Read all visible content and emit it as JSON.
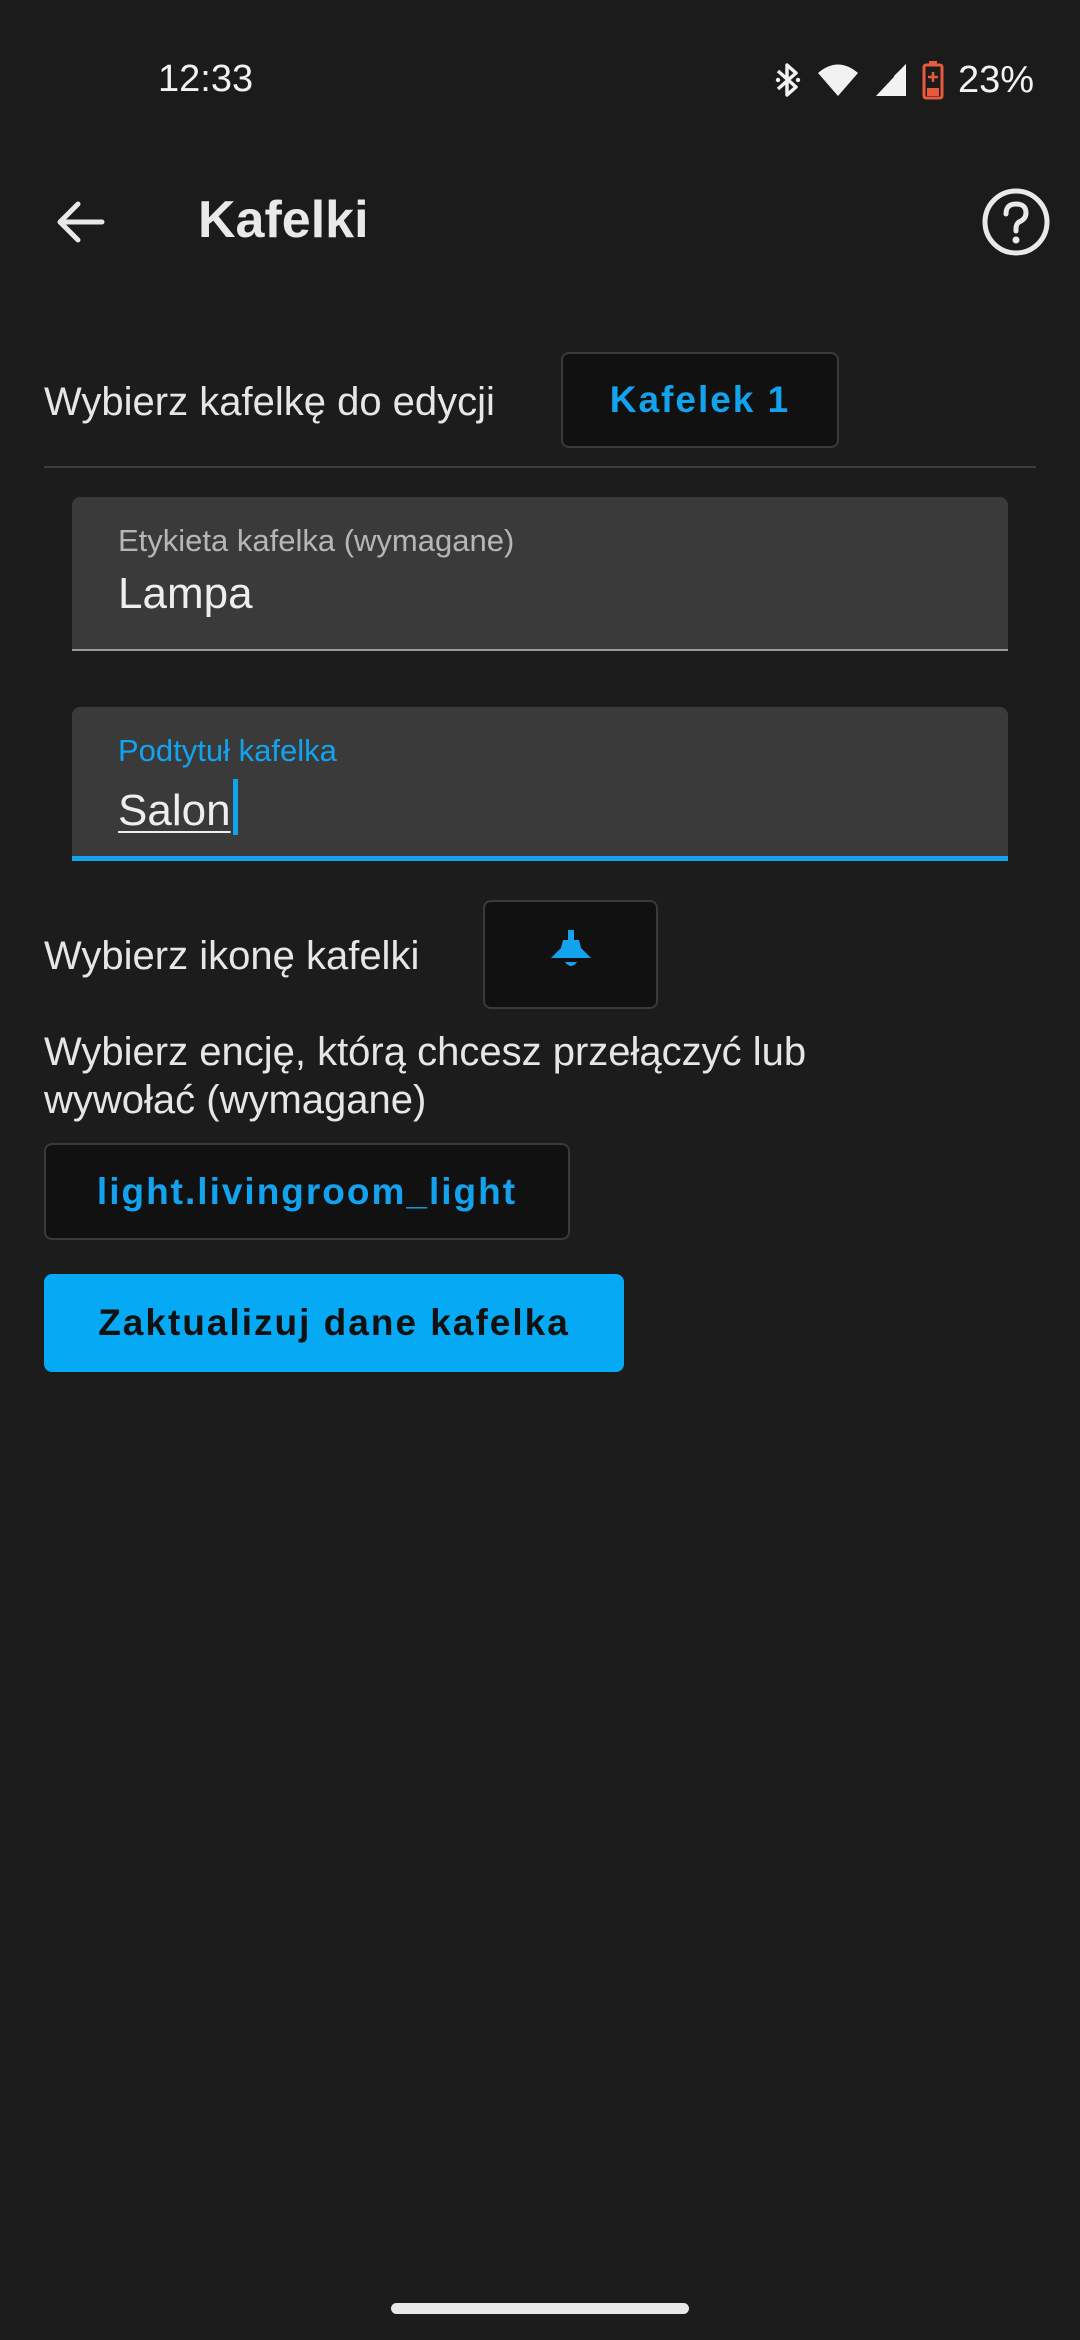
{
  "status_bar": {
    "time": "12:33",
    "battery_percent": "23%",
    "icons": [
      "bluetooth-icon",
      "wifi-icon",
      "signal-icon",
      "battery-icon"
    ]
  },
  "app_bar": {
    "title": "Kafelki",
    "back_icon": "arrow-back-icon",
    "help_icon": "help-circle-icon"
  },
  "tile_selector": {
    "label": "Wybierz kafelkę do edycji",
    "value": "Kafelek 1"
  },
  "label_field": {
    "label": "Etykieta kafelka (wymagane)",
    "value": "Lampa"
  },
  "subtitle_field": {
    "label": "Podtytuł kafelka",
    "value": "Salon"
  },
  "icon_selector": {
    "label": "Wybierz ikonę kafelki",
    "icon": "ceiling-lamp-icon"
  },
  "entity_selector": {
    "label_line1": "Wybierz encję, którą chcesz przełączyć lub",
    "label_line2": "wywołać (wymagane)",
    "value": "light.livingroom_light"
  },
  "update_button": {
    "label": "Zaktualizuj dane kafelka"
  },
  "colors": {
    "accent": "#13a3ee",
    "button": "#06a9f4",
    "background": "#1c1c1d",
    "field": "#3a3a3a"
  }
}
